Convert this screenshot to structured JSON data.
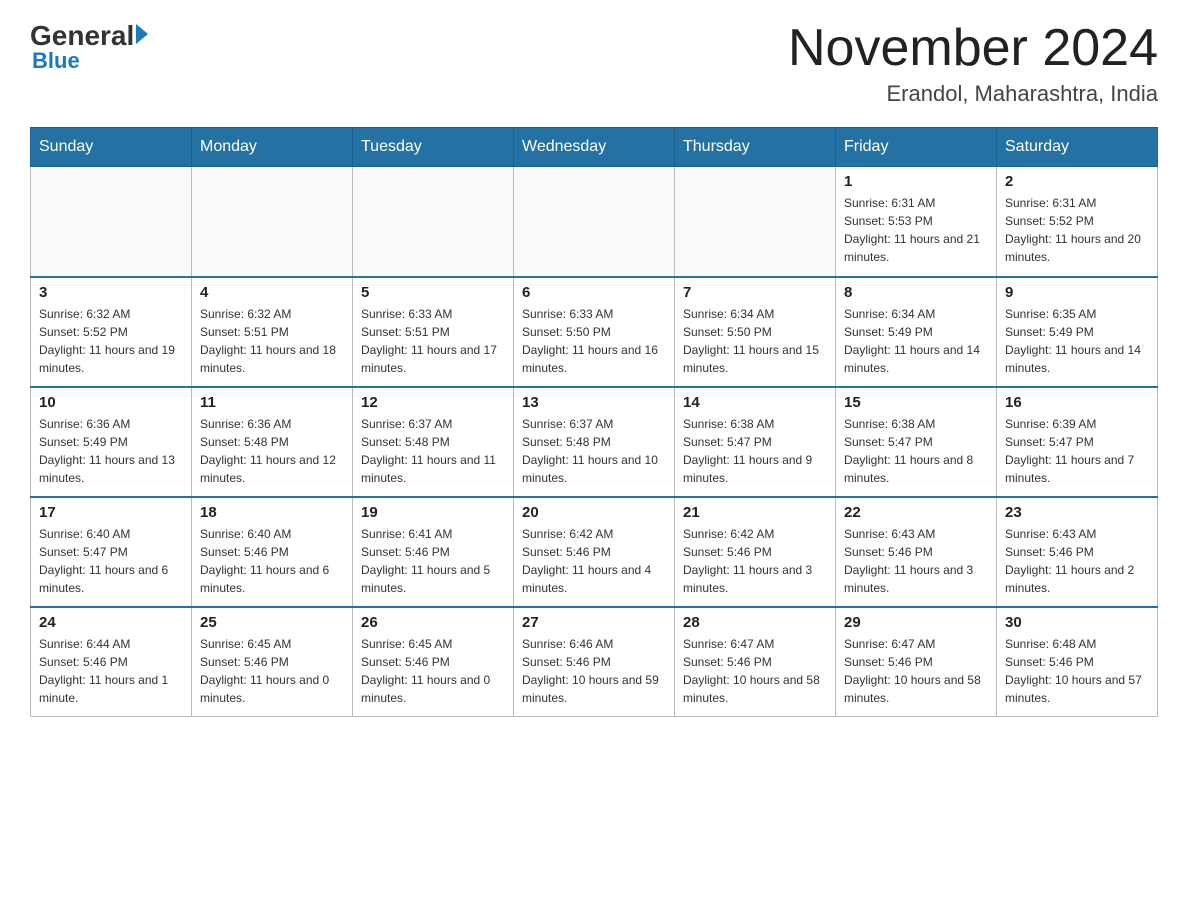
{
  "header": {
    "logo_general": "General",
    "logo_blue": "Blue",
    "month_title": "November 2024",
    "location": "Erandol, Maharashtra, India"
  },
  "days_of_week": [
    "Sunday",
    "Monday",
    "Tuesday",
    "Wednesday",
    "Thursday",
    "Friday",
    "Saturday"
  ],
  "weeks": [
    [
      {
        "day": "",
        "info": ""
      },
      {
        "day": "",
        "info": ""
      },
      {
        "day": "",
        "info": ""
      },
      {
        "day": "",
        "info": ""
      },
      {
        "day": "",
        "info": ""
      },
      {
        "day": "1",
        "info": "Sunrise: 6:31 AM\nSunset: 5:53 PM\nDaylight: 11 hours and 21 minutes."
      },
      {
        "day": "2",
        "info": "Sunrise: 6:31 AM\nSunset: 5:52 PM\nDaylight: 11 hours and 20 minutes."
      }
    ],
    [
      {
        "day": "3",
        "info": "Sunrise: 6:32 AM\nSunset: 5:52 PM\nDaylight: 11 hours and 19 minutes."
      },
      {
        "day": "4",
        "info": "Sunrise: 6:32 AM\nSunset: 5:51 PM\nDaylight: 11 hours and 18 minutes."
      },
      {
        "day": "5",
        "info": "Sunrise: 6:33 AM\nSunset: 5:51 PM\nDaylight: 11 hours and 17 minutes."
      },
      {
        "day": "6",
        "info": "Sunrise: 6:33 AM\nSunset: 5:50 PM\nDaylight: 11 hours and 16 minutes."
      },
      {
        "day": "7",
        "info": "Sunrise: 6:34 AM\nSunset: 5:50 PM\nDaylight: 11 hours and 15 minutes."
      },
      {
        "day": "8",
        "info": "Sunrise: 6:34 AM\nSunset: 5:49 PM\nDaylight: 11 hours and 14 minutes."
      },
      {
        "day": "9",
        "info": "Sunrise: 6:35 AM\nSunset: 5:49 PM\nDaylight: 11 hours and 14 minutes."
      }
    ],
    [
      {
        "day": "10",
        "info": "Sunrise: 6:36 AM\nSunset: 5:49 PM\nDaylight: 11 hours and 13 minutes."
      },
      {
        "day": "11",
        "info": "Sunrise: 6:36 AM\nSunset: 5:48 PM\nDaylight: 11 hours and 12 minutes."
      },
      {
        "day": "12",
        "info": "Sunrise: 6:37 AM\nSunset: 5:48 PM\nDaylight: 11 hours and 11 minutes."
      },
      {
        "day": "13",
        "info": "Sunrise: 6:37 AM\nSunset: 5:48 PM\nDaylight: 11 hours and 10 minutes."
      },
      {
        "day": "14",
        "info": "Sunrise: 6:38 AM\nSunset: 5:47 PM\nDaylight: 11 hours and 9 minutes."
      },
      {
        "day": "15",
        "info": "Sunrise: 6:38 AM\nSunset: 5:47 PM\nDaylight: 11 hours and 8 minutes."
      },
      {
        "day": "16",
        "info": "Sunrise: 6:39 AM\nSunset: 5:47 PM\nDaylight: 11 hours and 7 minutes."
      }
    ],
    [
      {
        "day": "17",
        "info": "Sunrise: 6:40 AM\nSunset: 5:47 PM\nDaylight: 11 hours and 6 minutes."
      },
      {
        "day": "18",
        "info": "Sunrise: 6:40 AM\nSunset: 5:46 PM\nDaylight: 11 hours and 6 minutes."
      },
      {
        "day": "19",
        "info": "Sunrise: 6:41 AM\nSunset: 5:46 PM\nDaylight: 11 hours and 5 minutes."
      },
      {
        "day": "20",
        "info": "Sunrise: 6:42 AM\nSunset: 5:46 PM\nDaylight: 11 hours and 4 minutes."
      },
      {
        "day": "21",
        "info": "Sunrise: 6:42 AM\nSunset: 5:46 PM\nDaylight: 11 hours and 3 minutes."
      },
      {
        "day": "22",
        "info": "Sunrise: 6:43 AM\nSunset: 5:46 PM\nDaylight: 11 hours and 3 minutes."
      },
      {
        "day": "23",
        "info": "Sunrise: 6:43 AM\nSunset: 5:46 PM\nDaylight: 11 hours and 2 minutes."
      }
    ],
    [
      {
        "day": "24",
        "info": "Sunrise: 6:44 AM\nSunset: 5:46 PM\nDaylight: 11 hours and 1 minute."
      },
      {
        "day": "25",
        "info": "Sunrise: 6:45 AM\nSunset: 5:46 PM\nDaylight: 11 hours and 0 minutes."
      },
      {
        "day": "26",
        "info": "Sunrise: 6:45 AM\nSunset: 5:46 PM\nDaylight: 11 hours and 0 minutes."
      },
      {
        "day": "27",
        "info": "Sunrise: 6:46 AM\nSunset: 5:46 PM\nDaylight: 10 hours and 59 minutes."
      },
      {
        "day": "28",
        "info": "Sunrise: 6:47 AM\nSunset: 5:46 PM\nDaylight: 10 hours and 58 minutes."
      },
      {
        "day": "29",
        "info": "Sunrise: 6:47 AM\nSunset: 5:46 PM\nDaylight: 10 hours and 58 minutes."
      },
      {
        "day": "30",
        "info": "Sunrise: 6:48 AM\nSunset: 5:46 PM\nDaylight: 10 hours and 57 minutes."
      }
    ]
  ]
}
